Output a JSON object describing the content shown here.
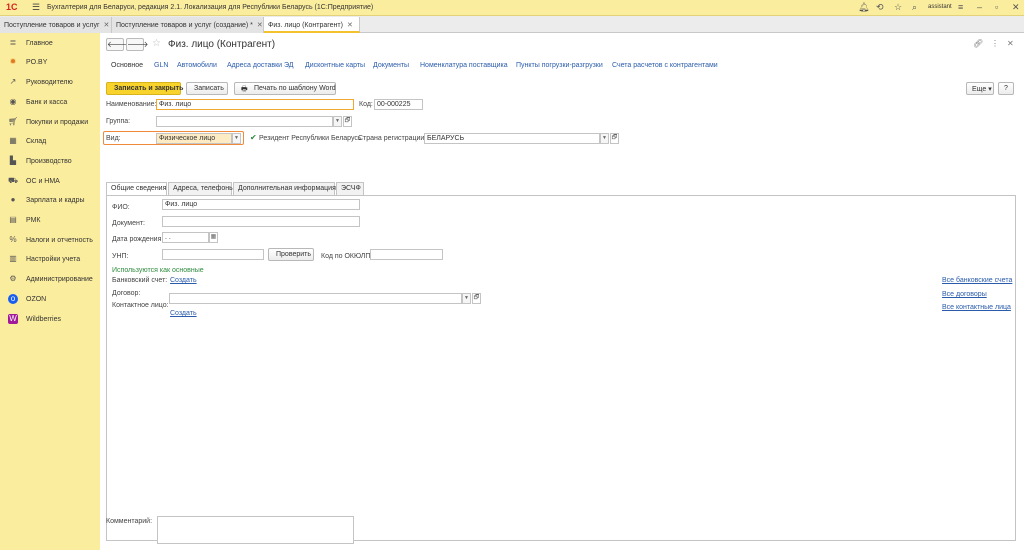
{
  "titlebar": {
    "logo": "1С",
    "title": "Бухгалтерия для Беларуси, редакция 2.1. Локализация для Республики Беларусь   (1С:Предприятие)",
    "user": "assistant"
  },
  "window_tabs": [
    {
      "label": "Поступление товаров и услуг"
    },
    {
      "label": "Поступление товаров и услуг (создание) *"
    },
    {
      "label": "Физ. лицо (Контрагент)"
    }
  ],
  "sidebar": {
    "items": [
      {
        "label": "Главное",
        "icon": "menu-icon"
      },
      {
        "label": "PO.BY",
        "icon": "sun-icon"
      },
      {
        "label": "Руководителю",
        "icon": "trend-icon"
      },
      {
        "label": "Банк и касса",
        "icon": "bank-icon"
      },
      {
        "label": "Покупки и продажи",
        "icon": "cart-icon"
      },
      {
        "label": "Склад",
        "icon": "warehouse-icon"
      },
      {
        "label": "Производство",
        "icon": "factory-icon"
      },
      {
        "label": "ОС и НМА",
        "icon": "car-icon"
      },
      {
        "label": "Зарплата и кадры",
        "icon": "person-icon"
      },
      {
        "label": "РМК",
        "icon": "register-icon"
      },
      {
        "label": "Налоги и отчетность",
        "icon": "tax-icon"
      },
      {
        "label": "Настройки учета",
        "icon": "book-icon"
      },
      {
        "label": "Администрирование",
        "icon": "gear-icon"
      },
      {
        "label": "OZON",
        "icon": "ozon-icon"
      },
      {
        "label": "Wildberries",
        "icon": "wildberries-icon"
      }
    ]
  },
  "form": {
    "title": "Физ. лицо (Контрагент)",
    "nav_links": [
      "Основное",
      "GLN",
      "Автомобили",
      "Адреса доставки ЭД",
      "Дисконтные карты",
      "Документы",
      "Номенклатура поставщика",
      "Пункты погрузки-разгрузки",
      "Счета расчетов с контрагентами"
    ],
    "buttons": {
      "save_close": "Записать и закрыть",
      "save": "Записать",
      "print_word": "Печать по шаблону Word",
      "more": "Еще",
      "help": "?"
    },
    "fields": {
      "name_label": "Наименование:",
      "name_value": "Физ. лицо",
      "code_label": "Код:",
      "code_value": "00-000225",
      "group_label": "Группа:",
      "group_value": "",
      "kind_label": "Вид:",
      "kind_value": "Физическое лицо",
      "resident_label": "Резидент Республики Беларусь",
      "country_label": "Страна регистрации:",
      "country_value": "БЕЛАРУСЬ"
    },
    "tabs": [
      "Общие сведения",
      "Адреса, телефоны",
      "Дополнительная информация",
      "ЭСЧФ"
    ],
    "general": {
      "fio_label": "ФИО:",
      "fio_value": "Физ. лицо",
      "document_label": "Документ:",
      "document_value": "",
      "birth_label": "Дата рождения:",
      "birth_value": " .  .",
      "unp_label": "УНП:",
      "unp_value": "",
      "check_button": "Проверить",
      "okpo_label": "Код по ОКЮЛП:",
      "okpo_value": "",
      "used_main": "Используются как основные",
      "bank_label": "Банковский счет:",
      "bank_create": "Создать",
      "contract_label": "Договор:",
      "contract_value": "",
      "contact_label": "Контактное лицо:",
      "contact_create": "Создать",
      "all_bank": "Все банковские счета",
      "all_contracts": "Все договоры",
      "all_contacts": "Все контактные лица"
    },
    "comment_label": "Комментарий:",
    "comment_value": ""
  },
  "colors": {
    "sidebar_bg": "#fbed9e",
    "primary_button": "#f7d32c",
    "link": "#2b5cab",
    "green_text": "#2e8b3e"
  }
}
